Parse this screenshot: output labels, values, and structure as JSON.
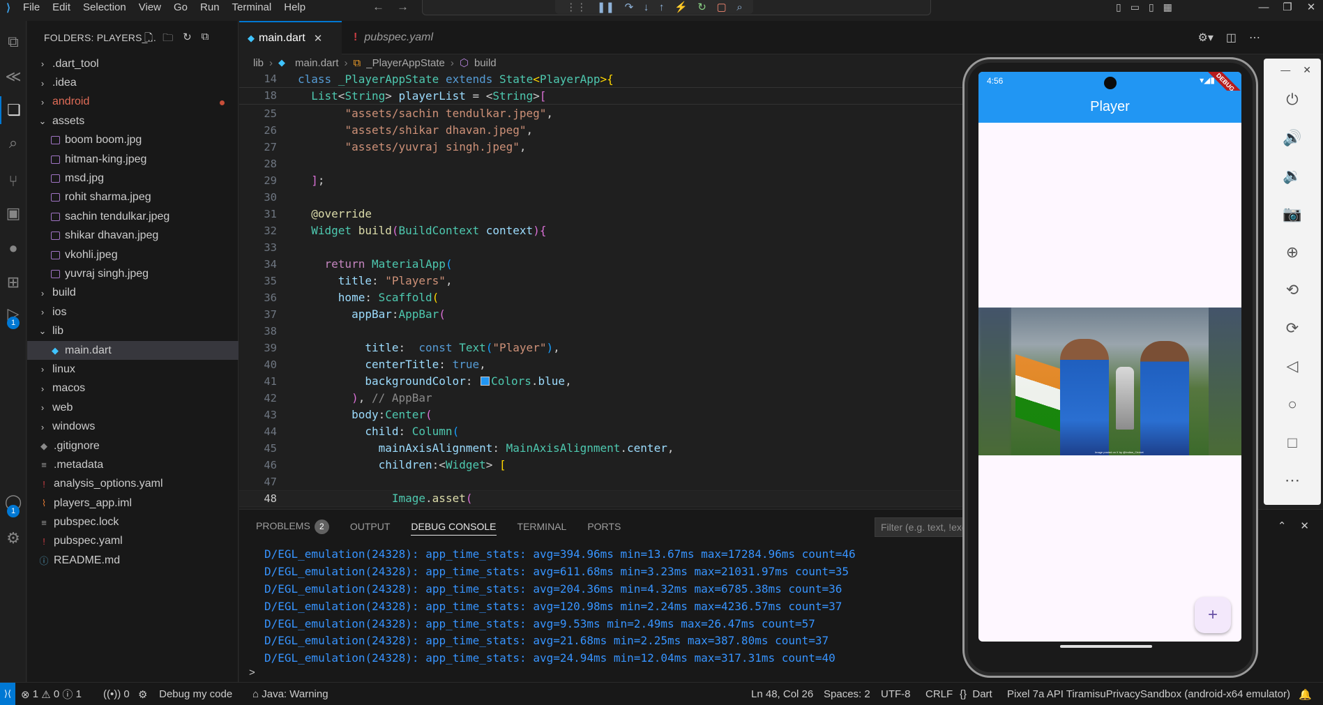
{
  "menu": [
    "File",
    "Edit",
    "Selection",
    "View",
    "Go",
    "Run",
    "Terminal",
    "Help"
  ],
  "sidebar": {
    "header": "FOLDERS: PLAYERS_...",
    "items": [
      {
        "label": ".dart_tool",
        "type": "folder",
        "indent": 1,
        "open": false
      },
      {
        "label": ".idea",
        "type": "folder",
        "indent": 1,
        "open": false
      },
      {
        "label": "android",
        "type": "folder",
        "indent": 1,
        "open": false,
        "modified": true
      },
      {
        "label": "assets",
        "type": "folder",
        "indent": 1,
        "open": true
      },
      {
        "label": "boom boom.jpg",
        "type": "image",
        "indent": 2
      },
      {
        "label": "hitman-king.jpeg",
        "type": "image",
        "indent": 2
      },
      {
        "label": "msd.jpg",
        "type": "image",
        "indent": 2
      },
      {
        "label": "rohit sharma.jpeg",
        "type": "image",
        "indent": 2
      },
      {
        "label": "sachin tendulkar.jpeg",
        "type": "image",
        "indent": 2
      },
      {
        "label": "shikar dhavan.jpeg",
        "type": "image",
        "indent": 2
      },
      {
        "label": "vkohli.jpeg",
        "type": "image",
        "indent": 2
      },
      {
        "label": "yuvraj singh.jpeg",
        "type": "image",
        "indent": 2
      },
      {
        "label": "build",
        "type": "folder",
        "indent": 1,
        "open": false
      },
      {
        "label": "ios",
        "type": "folder",
        "indent": 1,
        "open": false
      },
      {
        "label": "lib",
        "type": "folder",
        "indent": 1,
        "open": true
      },
      {
        "label": "main.dart",
        "type": "dart",
        "indent": 2,
        "selected": true
      },
      {
        "label": "linux",
        "type": "folder",
        "indent": 1,
        "open": false
      },
      {
        "label": "macos",
        "type": "folder",
        "indent": 1,
        "open": false
      },
      {
        "label": "web",
        "type": "folder",
        "indent": 1,
        "open": false
      },
      {
        "label": "windows",
        "type": "folder",
        "indent": 1,
        "open": false
      },
      {
        "label": ".gitignore",
        "type": "git",
        "indent": 1
      },
      {
        "label": ".metadata",
        "type": "text",
        "indent": 1
      },
      {
        "label": "analysis_options.yaml",
        "type": "yaml",
        "indent": 1
      },
      {
        "label": "players_app.iml",
        "type": "rss",
        "indent": 1
      },
      {
        "label": "pubspec.lock",
        "type": "text",
        "indent": 1
      },
      {
        "label": "pubspec.yaml",
        "type": "yaml",
        "indent": 1
      },
      {
        "label": "README.md",
        "type": "info",
        "indent": 1
      }
    ]
  },
  "tabs": [
    {
      "label": "main.dart",
      "active": true
    },
    {
      "label": "pubspec.yaml",
      "active": false
    }
  ],
  "breadcrumb": [
    "lib",
    "main.dart",
    "_PlayerAppState",
    "build"
  ],
  "activity_badges": {
    "run_debug": "1",
    "accounts": "1"
  },
  "panel": {
    "tabs": [
      "PROBLEMS",
      "OUTPUT",
      "DEBUG CONSOLE",
      "TERMINAL",
      "PORTS"
    ],
    "problems_count": "2",
    "active_tab": "DEBUG CONSOLE",
    "filter_placeholder": "Filter (e.g. text, !exclude, \\escape)",
    "console_lines": [
      "D/EGL_emulation(24328): app_time_stats: avg=394.96ms min=13.67ms max=17284.96ms count=46",
      "D/EGL_emulation(24328): app_time_stats: avg=611.68ms min=3.23ms max=21031.97ms count=35",
      "D/EGL_emulation(24328): app_time_stats: avg=204.36ms min=4.32ms max=6785.38ms count=36",
      "D/EGL_emulation(24328): app_time_stats: avg=120.98ms min=2.24ms max=4236.57ms count=37",
      "D/EGL_emulation(24328): app_time_stats: avg=9.53ms min=2.49ms max=26.47ms count=57",
      "D/EGL_emulation(24328): app_time_stats: avg=21.68ms min=2.25ms max=387.80ms count=37",
      "D/EGL_emulation(24328): app_time_stats: avg=24.94ms min=12.04ms max=317.31ms count=40"
    ],
    "prompt": ">"
  },
  "statusbar": {
    "errors": "1",
    "warnings": "0",
    "infos": "1",
    "ports": "0",
    "debug": "Debug my code",
    "java": "Java: Warning",
    "position": "Ln 48, Col 26",
    "spaces": "Spaces: 2",
    "encoding": "UTF-8",
    "eol": "CRLF",
    "language": "Dart",
    "device": "Pixel 7a API TiramisuPrivacySandbox (android-x64 emulator)"
  },
  "emulator": {
    "time": "4:56",
    "app_title": "Player",
    "debug_banner": "DEBUG",
    "fab": "+",
    "photo_caption": "Image posted on X by @Indian_Cricket",
    "side_buttons": [
      "power-icon",
      "volume-up-icon",
      "volume-down-icon",
      "camera-icon",
      "zoom-icon",
      "rotate-left-icon",
      "rotate-right-icon",
      "back-icon",
      "home-icon",
      "overview-icon",
      "more-icon"
    ]
  },
  "colors": {
    "accent": "#0078d4",
    "appbar": "#2196f3",
    "console_text": "#3794ff"
  }
}
